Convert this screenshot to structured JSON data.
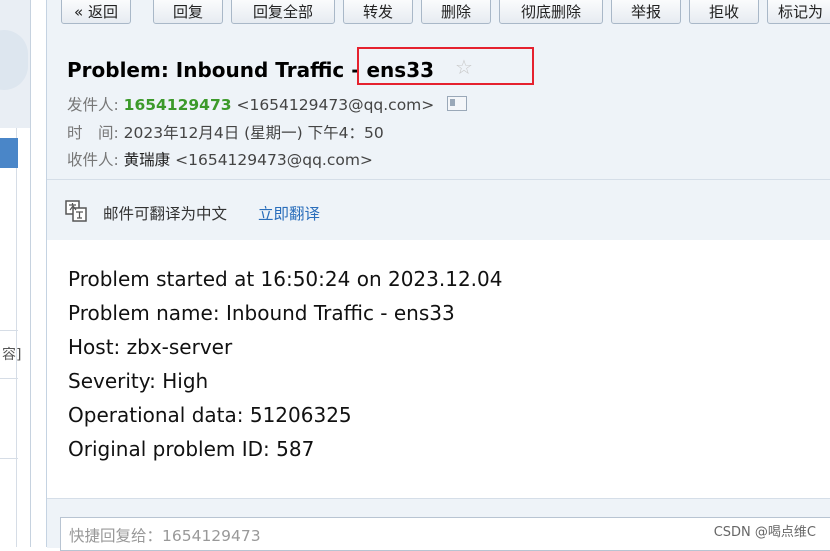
{
  "toolbar": {
    "back": "« 返回",
    "reply": "回复",
    "reply_all": "回复全部",
    "forward": "转发",
    "delete": "删除",
    "delete_permanently": "彻底删除",
    "report": "举报",
    "reject": "拒收",
    "mark_as": "标记为"
  },
  "email": {
    "subject": "Problem: Inbound Traffic - ens33",
    "from_label": "发件人:",
    "from_name": "1654129473",
    "from_address": "<1654129473@qq.com>",
    "time_label": "时　间:",
    "time_value": "2023年12月4日 (星期一) 下午4：50",
    "to_label": "收件人:",
    "to_name": "黄瑞康",
    "to_address": "<1654129473@qq.com>"
  },
  "translate": {
    "notice": "邮件可翻译为中文",
    "action": "立即翻译"
  },
  "body_lines": [
    "Problem started at 16:50:24 on 2023.12.04",
    "Problem name: Inbound Traffic - ens33",
    "Host: zbx-server",
    "Severity: High",
    "Operational data: 51206325",
    "Original problem ID: 587"
  ],
  "quick_reply": {
    "placeholder": "快捷回复给：1654129473"
  },
  "sidebar": {
    "fragment": "容]"
  },
  "watermark": "CSDN @喝点维C",
  "colors": {
    "highlight_box": "#e5212e",
    "sender": "#3c9a2a",
    "link": "#2a6ebb"
  }
}
